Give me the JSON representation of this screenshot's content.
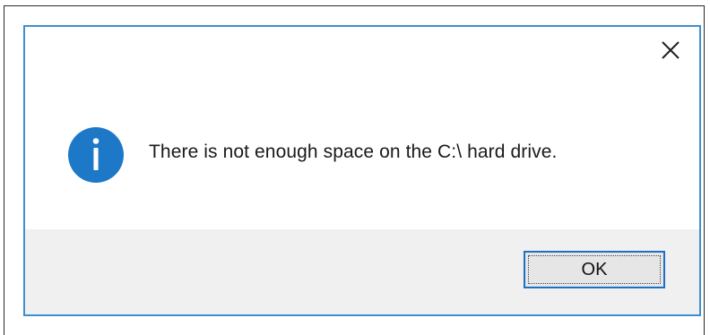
{
  "dialog": {
    "message": "There is not enough space on the C:\\ hard drive.",
    "icon": "info-icon",
    "ok_label": "OK",
    "close_icon": "close-icon",
    "colors": {
      "accent": "#3d8fd1",
      "icon_fill": "#1e78c8",
      "footer_bg": "#f0f0f0",
      "button_border": "#1f6fc4",
      "button_bg": "#e6e6e6"
    }
  }
}
